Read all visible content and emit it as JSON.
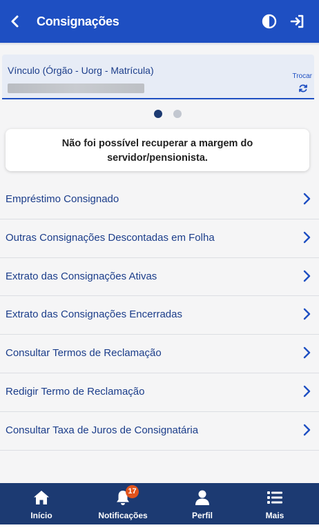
{
  "header": {
    "title": "Consignações",
    "back_icon": "back-arrow-icon",
    "contrast_icon": "contrast-icon",
    "logout_icon": "logout-icon",
    "color": "#1e4fc2"
  },
  "vinculo": {
    "label": "Vínculo (Órgão - Uorg - Matrícula)",
    "trocar_label": "Trocar",
    "refresh_icon": "refresh-icon"
  },
  "carousel": {
    "total": 2,
    "active_index": 0
  },
  "alert": {
    "message": "Não foi possível recuperar a margem do servidor/pensionista."
  },
  "menu": {
    "items": [
      {
        "label": "Empréstimo Consignado"
      },
      {
        "label": "Outras Consignações Descontadas em Folha"
      },
      {
        "label": "Extrato das Consignações Ativas"
      },
      {
        "label": "Extrato das Consignações Encerradas"
      },
      {
        "label": "Consultar Termos de Reclamação"
      },
      {
        "label": "Redigir Termo de Reclamação"
      },
      {
        "label": "Consultar Taxa de Juros de Consignatária"
      }
    ]
  },
  "tabbar": {
    "color": "#1c3a72",
    "tabs": [
      {
        "label": "Início",
        "icon": "home-icon"
      },
      {
        "label": "Notificações",
        "icon": "bell-icon",
        "badge": "17"
      },
      {
        "label": "Perfil",
        "icon": "user-icon"
      },
      {
        "label": "Mais",
        "icon": "list-icon"
      }
    ]
  }
}
